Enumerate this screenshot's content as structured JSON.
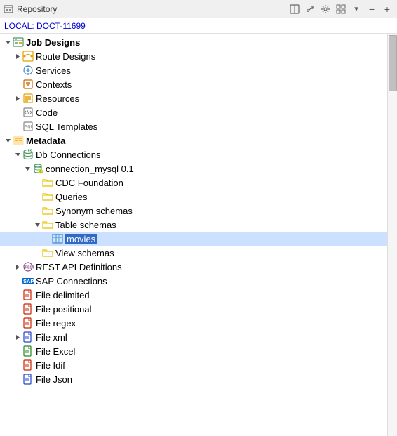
{
  "titleBar": {
    "label": "Repository",
    "buttons": [
      "minimize",
      "restore",
      "maximize",
      "close-menu",
      "collapse",
      "expand"
    ]
  },
  "location": "LOCAL: DOCT-11699",
  "toolbar": {
    "icons": [
      "panel-icon",
      "link-icon",
      "settings-icon",
      "grid-icon",
      "dropdown-icon",
      "minus-icon",
      "plus-icon"
    ]
  },
  "tree": {
    "items": [
      {
        "id": "job-designs",
        "label": "Job Designs",
        "bold": true,
        "indent": 0,
        "expanded": true,
        "icon": "job-icon",
        "has_expand": true
      },
      {
        "id": "route-designs",
        "label": "Route Designs",
        "bold": false,
        "indent": 1,
        "expanded": false,
        "icon": "route-icon",
        "has_expand": true
      },
      {
        "id": "services",
        "label": "Services",
        "bold": false,
        "indent": 1,
        "expanded": false,
        "icon": "services-icon",
        "has_expand": false
      },
      {
        "id": "contexts",
        "label": "Contexts",
        "bold": false,
        "indent": 1,
        "expanded": false,
        "icon": "contexts-icon",
        "has_expand": false
      },
      {
        "id": "resources",
        "label": "Resources",
        "bold": false,
        "indent": 1,
        "expanded": false,
        "icon": "resources-icon",
        "has_expand": true
      },
      {
        "id": "code",
        "label": "Code",
        "bold": false,
        "indent": 1,
        "expanded": false,
        "icon": "code-icon",
        "has_expand": false
      },
      {
        "id": "sql-templates",
        "label": "SQL Templates",
        "bold": false,
        "indent": 1,
        "expanded": false,
        "icon": "sql-icon",
        "has_expand": false
      },
      {
        "id": "metadata",
        "label": "Metadata",
        "bold": true,
        "indent": 0,
        "expanded": true,
        "icon": "metadata-icon",
        "has_expand": true
      },
      {
        "id": "db-connections",
        "label": "Db Connections",
        "bold": false,
        "indent": 1,
        "expanded": true,
        "icon": "db-icon",
        "has_expand": true
      },
      {
        "id": "connection-mysql",
        "label": "connection_mysql 0.1",
        "bold": false,
        "indent": 2,
        "expanded": true,
        "icon": "connection-icon",
        "has_expand": true
      },
      {
        "id": "cdc-foundation",
        "label": "CDC Foundation",
        "bold": false,
        "indent": 3,
        "expanded": false,
        "icon": "folder-icon",
        "has_expand": false
      },
      {
        "id": "queries",
        "label": "Queries",
        "bold": false,
        "indent": 3,
        "expanded": false,
        "icon": "folder-icon",
        "has_expand": false
      },
      {
        "id": "synonym-schemas",
        "label": "Synonym schemas",
        "bold": false,
        "indent": 3,
        "expanded": false,
        "icon": "folder-icon",
        "has_expand": false
      },
      {
        "id": "table-schemas",
        "label": "Table schemas",
        "bold": false,
        "indent": 3,
        "expanded": true,
        "icon": "folder-icon",
        "has_expand": true
      },
      {
        "id": "movies",
        "label": "movies",
        "bold": false,
        "indent": 4,
        "expanded": false,
        "icon": "table-icon",
        "has_expand": false,
        "selected": true
      },
      {
        "id": "view-schemas",
        "label": "View schemas",
        "bold": false,
        "indent": 3,
        "expanded": false,
        "icon": "folder-icon",
        "has_expand": false
      },
      {
        "id": "rest-api",
        "label": "REST API Definitions",
        "bold": false,
        "indent": 1,
        "expanded": false,
        "icon": "rest-icon",
        "has_expand": true
      },
      {
        "id": "sap-connections",
        "label": "SAP Connections",
        "bold": false,
        "indent": 1,
        "expanded": false,
        "icon": "sap-icon",
        "has_expand": false
      },
      {
        "id": "file-delimited",
        "label": "File delimited",
        "bold": false,
        "indent": 1,
        "expanded": false,
        "icon": "file-red-icon",
        "has_expand": false
      },
      {
        "id": "file-positional",
        "label": "File positional",
        "bold": false,
        "indent": 1,
        "expanded": false,
        "icon": "file-red-icon",
        "has_expand": false
      },
      {
        "id": "file-regex",
        "label": "File regex",
        "bold": false,
        "indent": 1,
        "expanded": false,
        "icon": "file-red-icon",
        "has_expand": false
      },
      {
        "id": "file-xml",
        "label": "File xml",
        "bold": false,
        "indent": 1,
        "expanded": false,
        "icon": "file-blue-icon",
        "has_expand": true
      },
      {
        "id": "file-excel",
        "label": "File Excel",
        "bold": false,
        "indent": 1,
        "expanded": false,
        "icon": "file-green-icon",
        "has_expand": false
      },
      {
        "id": "file-idif",
        "label": "File Idif",
        "bold": false,
        "indent": 1,
        "expanded": false,
        "icon": "file-red-icon",
        "has_expand": false
      },
      {
        "id": "file-json",
        "label": "File Json",
        "bold": false,
        "indent": 1,
        "expanded": false,
        "icon": "file-blue-icon",
        "has_expand": false
      }
    ]
  }
}
